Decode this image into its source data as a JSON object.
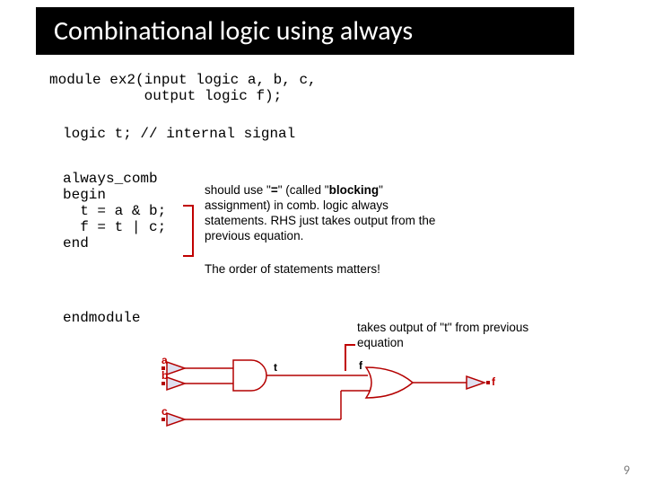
{
  "title": "Combinational logic using always",
  "module_decl": "module ex2(input logic a, b, c,\n           output logic f);",
  "signal_decl": "logic t; // internal signal",
  "always_block": "always_comb\nbegin\n  t = a & b;\n  f = t | c;\nend",
  "endmodule": "endmodule",
  "annot_blocking_1": "should use \"",
  "annot_blocking_eq": "=",
  "annot_blocking_2": "\" (called \"",
  "annot_blocking_3": "blocking",
  "annot_blocking_4": "\" assignment) in comb. logic always statements. RHS just takes output from the previous equation.",
  "annot_order": "The order of statements matters!",
  "annot_takes": "takes output of \"t\" from previous equation",
  "labels": {
    "a": "a",
    "b": "b",
    "c": "c",
    "t": "t",
    "f": "f",
    "f_out": "f"
  },
  "page_number": "9"
}
